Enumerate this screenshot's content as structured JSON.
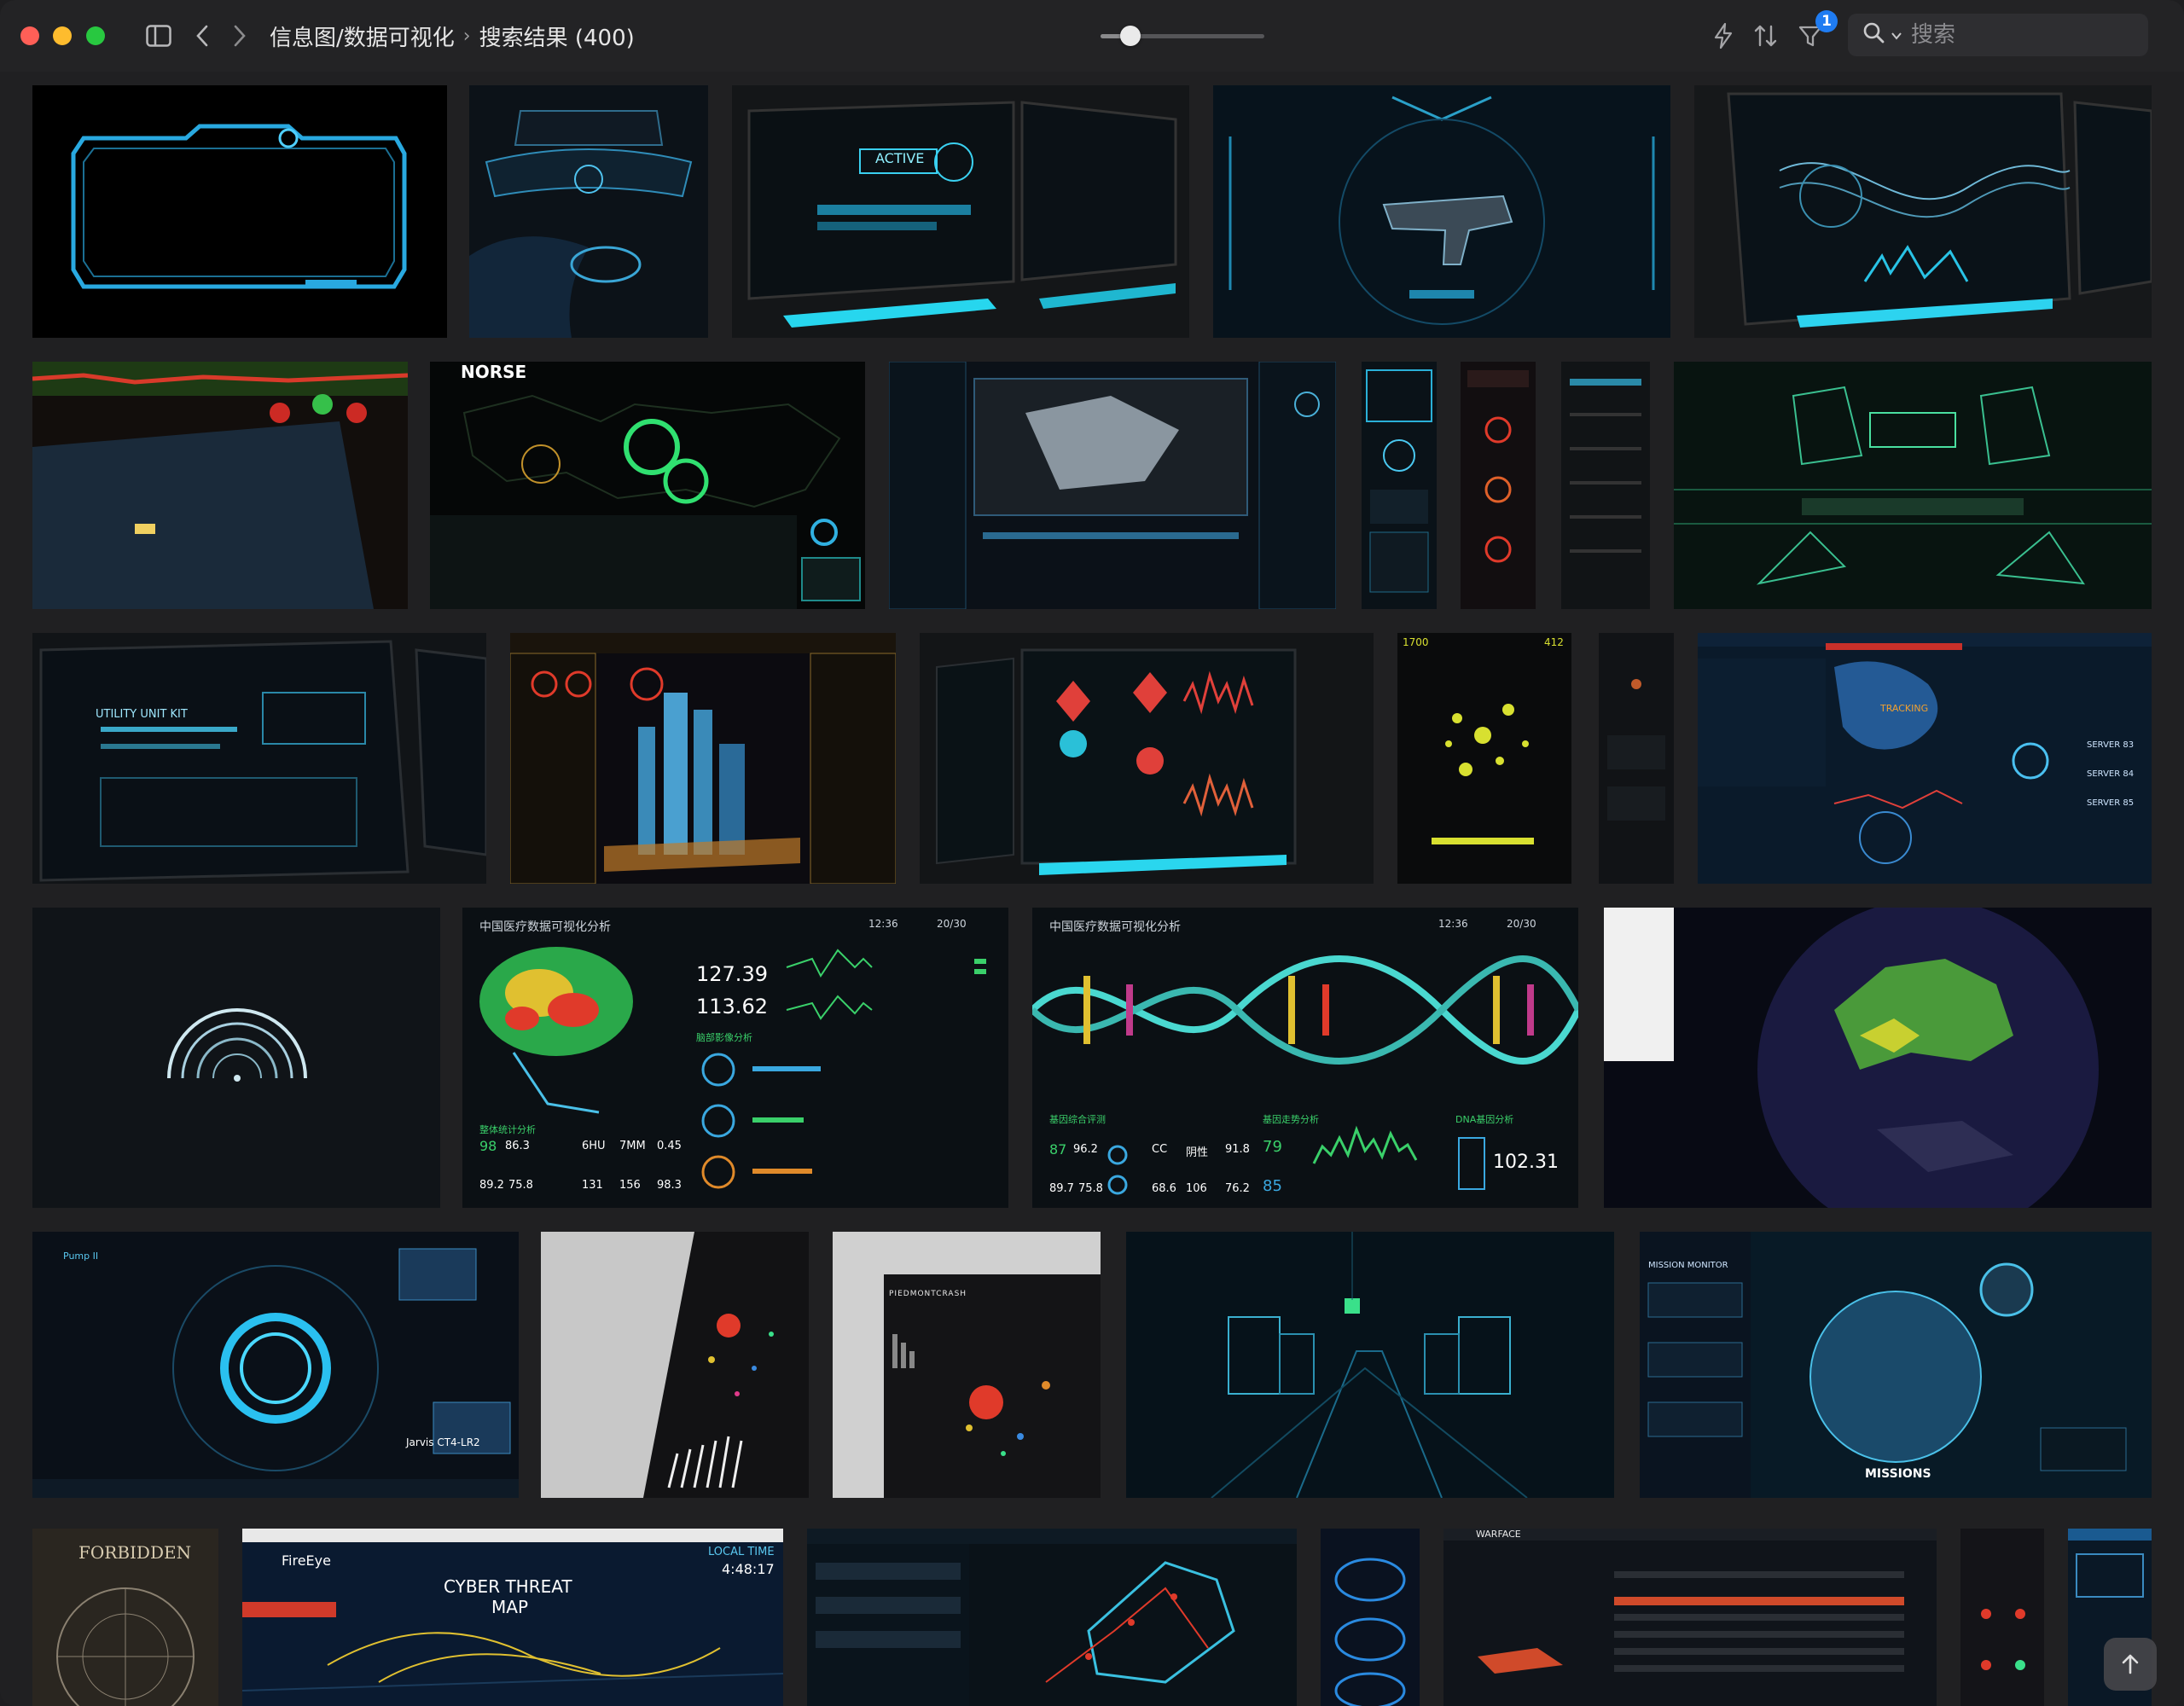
{
  "breadcrumb": {
    "parent": "信息图/数据可视化",
    "current": "搜索结果 (400)"
  },
  "zoom_slider": {
    "value": 0.18
  },
  "filter": {
    "count": "1"
  },
  "search": {
    "placeholder": "搜索"
  },
  "icons": {
    "sidebar": "sidebar-icon",
    "back": "chevron-left-icon",
    "forward": "chevron-right-icon",
    "lightning": "lightning-icon",
    "sort": "sort-icon",
    "filter": "filter-icon",
    "search": "search-icon",
    "scroll_top": "arrow-up-icon"
  },
  "thumb_text": {
    "active": "ACTIVE",
    "norse": "NORSE",
    "utility": "UTILITY UNIT KIT",
    "medical_title": "中国医疗数据可视化分析",
    "medical_time": "12:36",
    "medical_temp": "20/30",
    "brain_v1": "127.39",
    "brain_v2": "113.62",
    "brain_section": "脑部影像分析",
    "brain_stats": "整体统计分析",
    "brain_n1": "98",
    "brain_n2": "86.3",
    "brain_n3": "6HU",
    "brain_n4": "7MM",
    "brain_n5": "0.45",
    "brain_n6": "89.2",
    "brain_n7": "75.8",
    "brain_n8": "131",
    "brain_n9": "156",
    "brain_n10": "98.3",
    "dna_s1": "基因综合评测",
    "dna_s2": "基因走势分析",
    "dna_s3": "DNA基因分析",
    "dna_n1": "87",
    "dna_n2": "96.2",
    "dna_n3": "CC",
    "dna_n4": "阴性",
    "dna_n5": "91.8",
    "dna_n6": "79",
    "dna_n7": "89.7",
    "dna_n8": "75.8",
    "dna_n9": "68.6",
    "dna_n10": "106",
    "dna_n11": "76.2",
    "dna_n12": "85",
    "dna_big": "102.31",
    "pump": "Pump II",
    "jarvis": "Jarvis CT4-LR2",
    "piedmont": "PIEDMONTCRASH",
    "mission_monitor": "MISSION MONITOR",
    "missions": "MISSIONS",
    "forbidden": "FORBIDDEN",
    "fireeye": "FireEye",
    "cyber_threat": "CYBER THREAT",
    "cyber_map": "MAP",
    "local_time": "LOCAL TIME",
    "local_clock": "4:48:17",
    "warface": "WARFACE",
    "tracking": "TRACKING",
    "server1": "SERVER 83",
    "server2": "SERVER 84",
    "server3": "SERVER 85",
    "t1700": "1700",
    "t412": "412"
  },
  "colors": {
    "accent": "#1f7cf2",
    "cyan": "#29d8ff",
    "background": "#202022"
  }
}
